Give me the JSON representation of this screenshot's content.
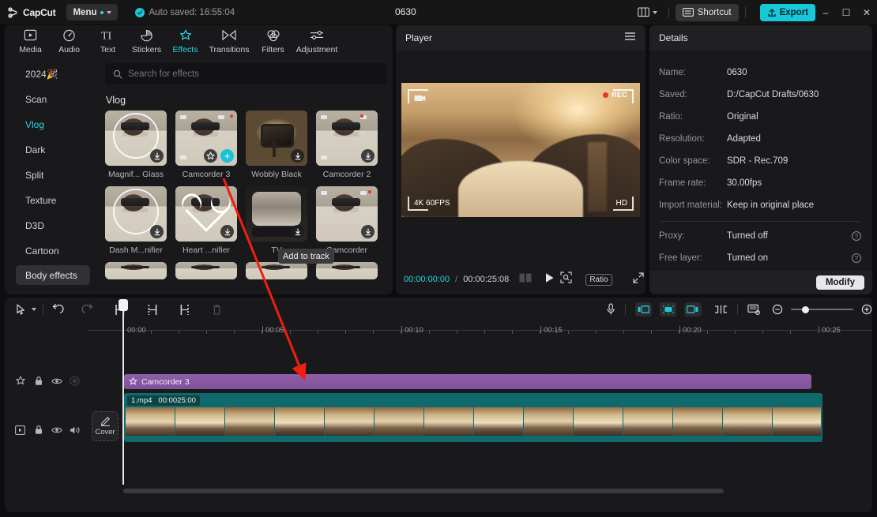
{
  "titlebar": {
    "logo_text": "CapCut",
    "menu_label": "Menu",
    "autosave_text": "Auto saved: 16:55:04",
    "project_title": "0630",
    "shortcut_label": "Shortcut",
    "export_label": "Export",
    "minimize": "–",
    "maximize": "☐",
    "close": "✕",
    "accent": "#16c8d8"
  },
  "nav_tabs": [
    {
      "label": "Media",
      "icon": "media-icon",
      "active": false
    },
    {
      "label": "Audio",
      "icon": "audio-icon",
      "active": false
    },
    {
      "label": "Text",
      "icon": "text-icon",
      "active": false
    },
    {
      "label": "Stickers",
      "icon": "stickers-icon",
      "active": false
    },
    {
      "label": "Effects",
      "icon": "effects-icon",
      "active": true
    },
    {
      "label": "Transitions",
      "icon": "transitions-icon",
      "active": false
    },
    {
      "label": "Filters",
      "icon": "filters-icon",
      "active": false
    },
    {
      "label": "Adjustment",
      "icon": "adjustment-icon",
      "active": false
    }
  ],
  "categories": [
    {
      "label": "2024🎉",
      "active": false,
      "pill": false
    },
    {
      "label": "Scan",
      "active": false,
      "pill": false
    },
    {
      "label": "Vlog",
      "active": true,
      "pill": false
    },
    {
      "label": "Dark",
      "active": false,
      "pill": false
    },
    {
      "label": "Split",
      "active": false,
      "pill": false
    },
    {
      "label": "Texture",
      "active": false,
      "pill": false
    },
    {
      "label": "D3D",
      "active": false,
      "pill": false
    },
    {
      "label": "Cartoon",
      "active": false,
      "pill": false
    },
    {
      "label": "Body effects",
      "active": false,
      "pill": true
    }
  ],
  "search": {
    "placeholder": "Search for effects"
  },
  "effects": {
    "group_title": "Vlog",
    "tooltip": "Add to track",
    "row1": [
      {
        "label": "Magnif... Glass",
        "art": "person-circle",
        "badge": "download"
      },
      {
        "label": "Camcorder 3",
        "art": "person-cam",
        "badge": "selected"
      },
      {
        "label": "Wobbly Black",
        "art": "tv-retro",
        "badge": "download"
      },
      {
        "label": "Camcorder 2",
        "art": "person-cam",
        "badge": "download"
      }
    ],
    "row2": [
      {
        "label": "Dash M...nifier",
        "art": "person-circle",
        "badge": "download"
      },
      {
        "label": "Heart ...nifier",
        "art": "person-heart",
        "badge": "download"
      },
      {
        "label": "TV",
        "art": "tv-dark",
        "badge": "download"
      },
      {
        "label": "Camcorder",
        "art": "person-cam",
        "badge": "download"
      }
    ]
  },
  "player": {
    "title": "Player",
    "current_time": "00:00:00:00",
    "separator": "/",
    "total_time": "00:00:25:08",
    "ratio_label": "Ratio",
    "overlay": {
      "rec": "REC",
      "fps": "4K 60FPS",
      "quality": "HD"
    }
  },
  "details": {
    "title": "Details",
    "rows": [
      {
        "key": "Name:",
        "value": "0630",
        "hint": false
      },
      {
        "key": "Saved:",
        "value": "D:/CapCut Drafts/0630",
        "hint": false
      },
      {
        "key": "Ratio:",
        "value": "Original",
        "hint": false
      },
      {
        "key": "Resolution:",
        "value": "Adapted",
        "hint": false
      },
      {
        "key": "Color space:",
        "value": "SDR - Rec.709",
        "hint": false
      },
      {
        "key": "Frame rate:",
        "value": "30.00fps",
        "hint": false
      },
      {
        "key": "Import material:",
        "value": "Keep in original place",
        "hint": false
      }
    ],
    "rows2": [
      {
        "key": "Proxy:",
        "value": "Turned off",
        "hint": true
      },
      {
        "key": "Free layer:",
        "value": "Turned on",
        "hint": true
      }
    ],
    "hint_glyph": "?",
    "modify_label": "Modify"
  },
  "timeline": {
    "ruler_labels": [
      "00:00",
      "00:05",
      "00:10",
      "00:15",
      "00:20",
      "00:25"
    ],
    "cover_label": "Cover",
    "effect_clip": {
      "label": "Camcorder 3"
    },
    "video_clip": {
      "name": "1.mp4",
      "duration": "00:0025:00"
    }
  }
}
